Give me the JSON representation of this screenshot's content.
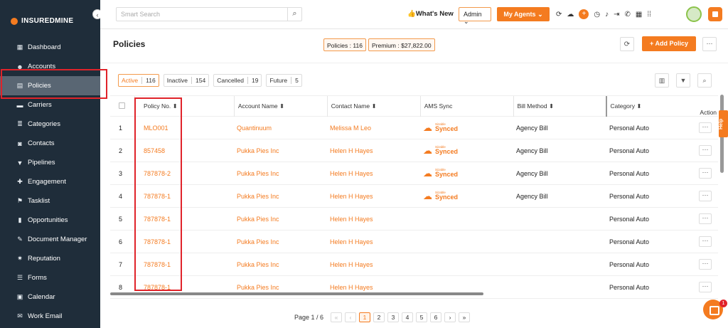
{
  "brand": {
    "name_bold": "INSUREDMINE",
    "name_thin": ""
  },
  "sidebar": {
    "items": [
      {
        "icon": "▦",
        "label": "Dashboard"
      },
      {
        "icon": "☻",
        "label": "Accounts"
      },
      {
        "icon": "▤",
        "label": "Policies"
      },
      {
        "icon": "▬",
        "label": "Carriers"
      },
      {
        "icon": "≣",
        "label": "Categories"
      },
      {
        "icon": "◙",
        "label": "Contacts"
      },
      {
        "icon": "▼",
        "label": "Pipelines"
      },
      {
        "icon": "✚",
        "label": "Engagement"
      },
      {
        "icon": "⚑",
        "label": "Tasklist"
      },
      {
        "icon": "▮",
        "label": "Opportunities"
      },
      {
        "icon": "✎",
        "label": "Document Manager"
      },
      {
        "icon": "✷",
        "label": "Reputation"
      },
      {
        "icon": "☰",
        "label": "Forms"
      },
      {
        "icon": "▣",
        "label": "Calendar"
      },
      {
        "icon": "✉",
        "label": "Work Email"
      }
    ]
  },
  "topbar": {
    "search_placeholder": "Smart Search",
    "whats_new": "👍What's New",
    "admin": "Admin ⌄",
    "my_agents": "My Agents ⌄"
  },
  "header": {
    "title": "Policies",
    "policies_count": "Policies : 116",
    "premium": "Premium : $27,822.00",
    "add_policy": "+ Add Policy"
  },
  "filters": [
    {
      "label": "Active",
      "count": "116"
    },
    {
      "label": "Inactive",
      "count": "154"
    },
    {
      "label": "Cancelled",
      "count": "19"
    },
    {
      "label": "Future",
      "count": "5"
    }
  ],
  "table": {
    "headers": {
      "policy_no": "Policy No. ⬍",
      "account_name": "Account Name ⬍",
      "contact_name": "Contact Name ⬍",
      "ams_sync": "AMS Sync",
      "bill_method": "Bill Method ⬍",
      "category": "Category ⬍",
      "action": "Action"
    },
    "sync_tiny": "Sizable",
    "sync_label": "Synced",
    "rows": [
      {
        "n": "1",
        "policy": "MLO001",
        "account": "Quantinuum",
        "contact": "Melissa M Leo",
        "bill": "Agency Bill",
        "category": "Personal Auto",
        "synced": true
      },
      {
        "n": "2",
        "policy": "857458",
        "account": "Pukka Pies Inc",
        "contact": "Helen H Hayes",
        "bill": "Agency Bill",
        "category": "Personal Auto",
        "synced": true
      },
      {
        "n": "3",
        "policy": "787878-2",
        "account": "Pukka Pies Inc",
        "contact": "Helen H Hayes",
        "bill": "Agency Bill",
        "category": "Personal Auto",
        "synced": true
      },
      {
        "n": "4",
        "policy": "787878-1",
        "account": "Pukka Pies Inc",
        "contact": "Helen H Hayes",
        "bill": "Agency Bill",
        "category": "Personal Auto",
        "synced": true
      },
      {
        "n": "5",
        "policy": "787878-1",
        "account": "Pukka Pies Inc",
        "contact": "Helen H Hayes",
        "bill": "",
        "category": "Personal Auto",
        "synced": false
      },
      {
        "n": "6",
        "policy": "787878-1",
        "account": "Pukka Pies Inc",
        "contact": "Helen H Hayes",
        "bill": "",
        "category": "Personal Auto",
        "synced": false
      },
      {
        "n": "7",
        "policy": "787878-1",
        "account": "Pukka Pies Inc",
        "contact": "Helen H Hayes",
        "bill": "",
        "category": "Personal Auto",
        "synced": false
      },
      {
        "n": "8",
        "policy": "787878-1",
        "account": "Pukka Pies Inc",
        "contact": "Helen H Hayes",
        "bill": "",
        "category": "Personal Auto",
        "synced": false
      }
    ]
  },
  "pagination": {
    "label": "Page 1 / 6",
    "first": "«",
    "prev": "‹",
    "pages": [
      "1",
      "2",
      "3",
      "4",
      "5",
      "6"
    ],
    "next": "›",
    "last": "»"
  },
  "help": "Help",
  "chat_badge": "1",
  "colors": {
    "accent": "#f47b20",
    "sidebar": "#1f2d3a",
    "highlight": "#e0232a"
  }
}
